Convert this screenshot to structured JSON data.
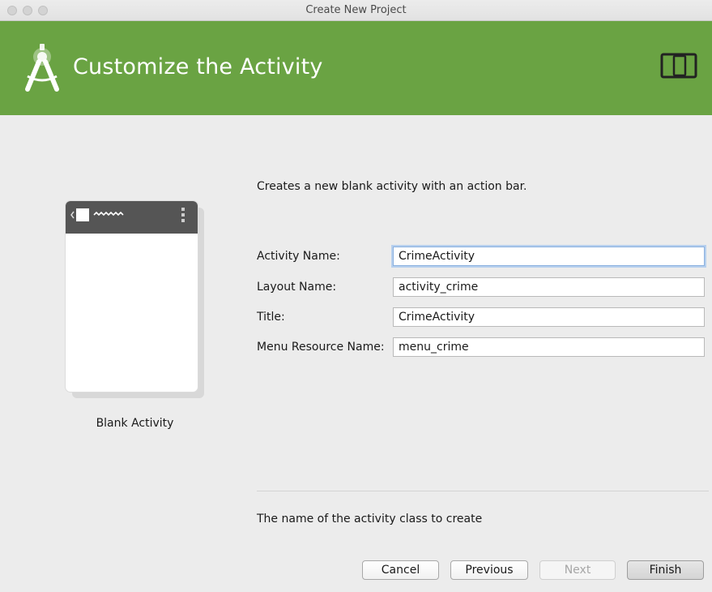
{
  "window": {
    "title": "Create New Project"
  },
  "header": {
    "title": "Customize the Activity",
    "logo_icon": "android-studio-logo-icon",
    "device_icon": "phone-tablet-icon",
    "background_color": "#6aa343"
  },
  "template": {
    "label": "Blank Activity"
  },
  "form": {
    "description": "Creates a new blank activity with an action bar.",
    "fields": [
      {
        "label": "Activity Name:",
        "value": "CrimeActivity"
      },
      {
        "label": "Layout Name:",
        "value": "activity_crime"
      },
      {
        "label": "Title:",
        "value": "CrimeActivity"
      },
      {
        "label": "Menu Resource Name:",
        "value": "menu_crime"
      }
    ],
    "help_text": "The name of the activity class to create"
  },
  "buttons": {
    "cancel": "Cancel",
    "previous": "Previous",
    "next": "Next",
    "finish": "Finish"
  }
}
